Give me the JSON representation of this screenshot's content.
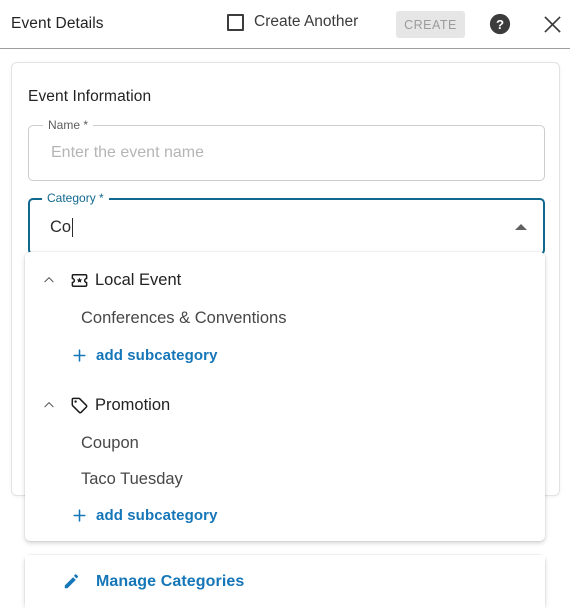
{
  "header": {
    "title": "Event Details",
    "create_another_label": "Create Another",
    "create_button_label": "CREATE",
    "help_icon": "help-icon",
    "close_icon": "close-icon",
    "checkbox_checked": false,
    "create_button_enabled": false
  },
  "card": {
    "section_title": "Event Information",
    "name_field": {
      "label": "Name *",
      "value": "",
      "placeholder": "Enter the event name"
    },
    "category_field": {
      "label": "Category *",
      "value": "Co",
      "placeholder": "",
      "expanded": true,
      "arrow_icon": "triangle-up-icon"
    }
  },
  "dropdown": {
    "groups": [
      {
        "label": "Local Event",
        "icon": "ticket-icon",
        "expanded": true,
        "collapse_icon": "chevron-up-icon",
        "subcategories": [
          "Conferences & Conventions"
        ],
        "add_label": "add subcategory",
        "add_icon": "plus-icon"
      },
      {
        "label": "Promotion",
        "icon": "tag-icon",
        "expanded": true,
        "collapse_icon": "chevron-up-icon",
        "subcategories": [
          "Coupon",
          "Taco Tuesday"
        ],
        "add_label": "add subcategory",
        "add_icon": "plus-icon"
      }
    ],
    "footer": {
      "label": "Manage Categories",
      "icon": "pencil-icon"
    }
  },
  "colors": {
    "accent_blue": "#1576b8",
    "focus_border": "#11688f",
    "text_primary": "#222222",
    "text_secondary": "#474747",
    "disabled_button_bg": "#e6e6e6",
    "disabled_button_text": "#9b9b9b"
  }
}
